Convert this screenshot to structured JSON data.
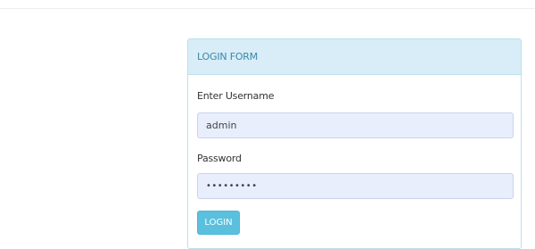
{
  "login_form": {
    "heading": "LOGIN FORM",
    "username": {
      "label": "Enter Username",
      "value": "admin"
    },
    "password": {
      "label": "Password",
      "value_masked": "•••••••••"
    },
    "submit_label": "LOGIN"
  },
  "colors": {
    "heading_background": "#d8edf7",
    "heading_text": "#3a87ad",
    "input_background": "#e8eefc",
    "button_background": "#5bc0de"
  }
}
